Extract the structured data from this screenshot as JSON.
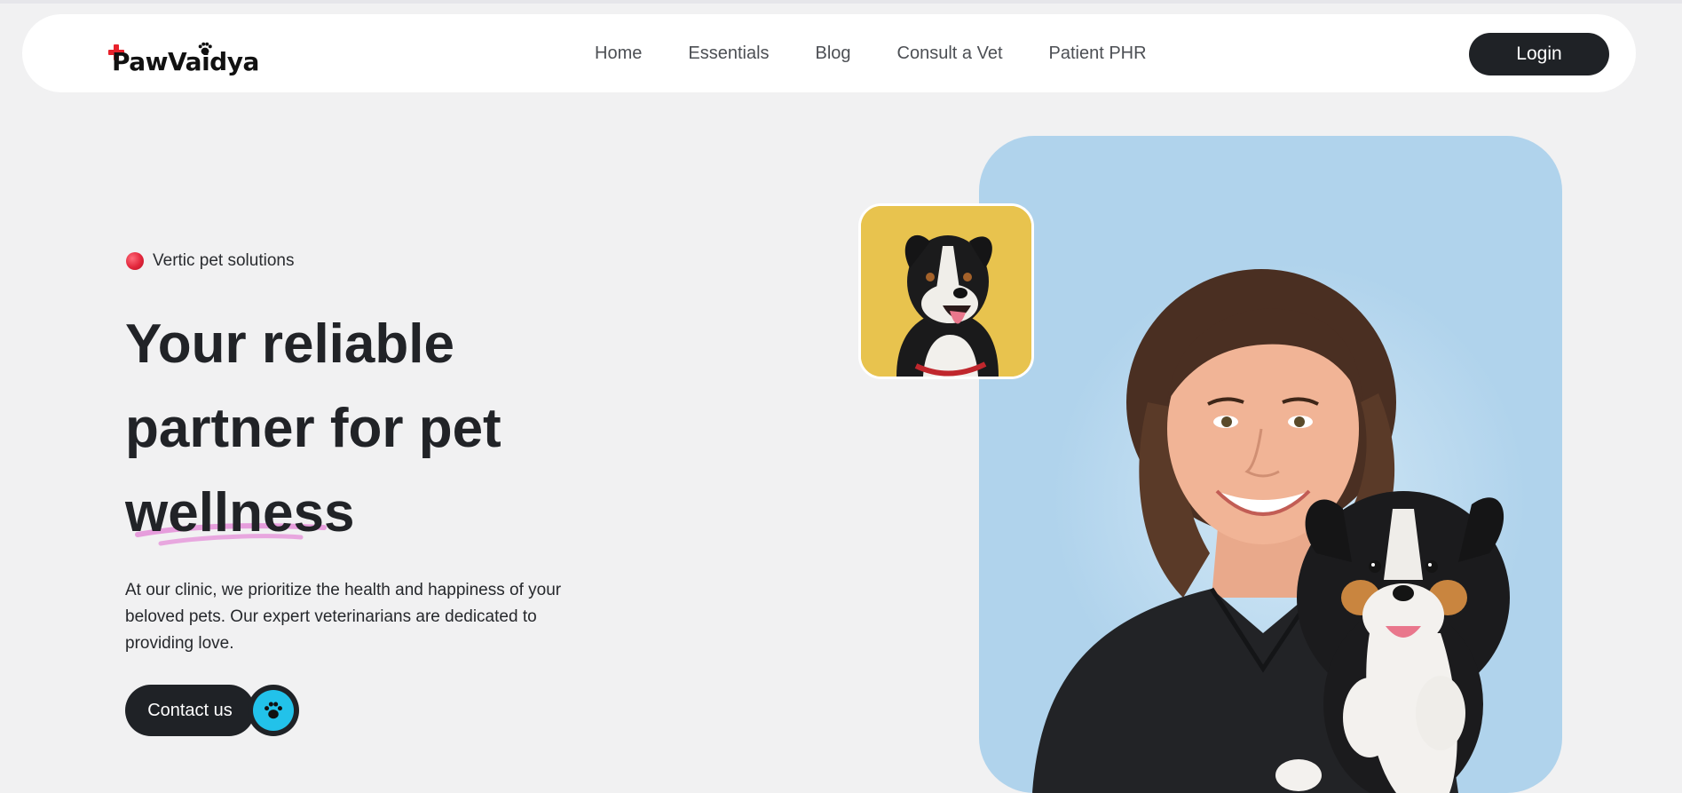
{
  "brand": {
    "name": "PawVaidya",
    "cross_color": "#e8212b"
  },
  "nav": {
    "links": [
      {
        "label": "Home"
      },
      {
        "label": "Essentials"
      },
      {
        "label": "Blog"
      },
      {
        "label": "Consult a Vet"
      },
      {
        "label": "Patient PHR"
      }
    ],
    "login_label": "Login"
  },
  "hero": {
    "tagline": "Vertic pet solutions",
    "headline": {
      "line1": "Your reliable",
      "line2": "partner for pet",
      "line3": "wellness"
    },
    "description": "At our clinic, we prioritize the health and happiness of your beloved pets. Our expert veterinarians are dedicated to providing love.",
    "contact_label": "Contact us",
    "accent_color": "#22c2ea",
    "card_color": "#b0d3ec",
    "thumb_color": "#e8c34e"
  },
  "icons": {
    "tagline_dot": "red-dot-icon",
    "contact_paw": "paw-icon",
    "logo_cross": "medical-cross-icon",
    "logo_paw": "paw-icon"
  }
}
